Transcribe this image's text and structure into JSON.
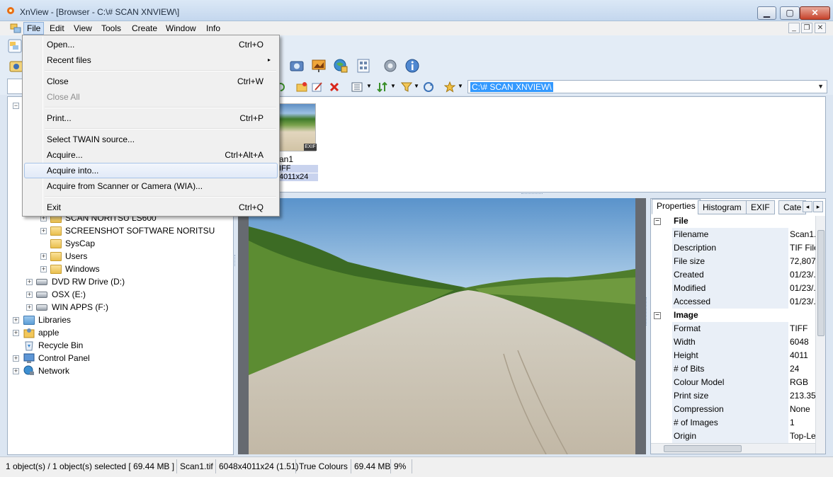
{
  "window": {
    "title": "XnView - [Browser - C:\\# SCAN XNVIEW\\]"
  },
  "menubar": {
    "items": [
      "File",
      "Edit",
      "View",
      "Tools",
      "Create",
      "Window",
      "Info"
    ]
  },
  "file_menu": {
    "items": [
      {
        "label": "Open...",
        "shortcut": "Ctrl+O"
      },
      {
        "label": "Recent files",
        "shortcut": ""
      },
      {
        "label": "Close",
        "shortcut": "Ctrl+W"
      },
      {
        "label": "Close All",
        "shortcut": ""
      },
      {
        "label": "Print...",
        "shortcut": "Ctrl+P"
      },
      {
        "label": "Select TWAIN source...",
        "shortcut": ""
      },
      {
        "label": "Acquire...",
        "shortcut": "Ctrl+Alt+A"
      },
      {
        "label": "Acquire into...",
        "shortcut": ""
      },
      {
        "label": "Acquire from Scanner or Camera (WIA)...",
        "shortcut": ""
      },
      {
        "label": "Exit",
        "shortcut": "Ctrl+Q"
      }
    ],
    "submenu_arrow": "▸"
  },
  "address": {
    "path": "C:\\# SCAN XNVIEW\\"
  },
  "tree": {
    "items": [
      {
        "label": "SCAN NORITSU LS600"
      },
      {
        "label": "SCREENSHOT SOFTWARE NORITSU"
      },
      {
        "label": "SysCap"
      },
      {
        "label": "Users"
      },
      {
        "label": "Windows"
      },
      {
        "label": "DVD RW Drive (D:)"
      },
      {
        "label": "OSX (E:)"
      },
      {
        "label": "WIN APPS (F:)"
      },
      {
        "label": "Libraries"
      },
      {
        "label": "apple"
      },
      {
        "label": "Recycle Bin"
      },
      {
        "label": "Control Panel"
      },
      {
        "label": "Network"
      }
    ]
  },
  "thumbnail": {
    "name": "an1",
    "type": "IFF",
    "dims": "4011x24",
    "badge": "EXIF"
  },
  "properties": {
    "tabs": [
      "Properties",
      "Histogram",
      "EXIF",
      "Cate"
    ],
    "sections": [
      {
        "title": "File",
        "rows": [
          {
            "key": "Filename",
            "value": "Scan1."
          },
          {
            "key": "Description",
            "value": "TIF File"
          },
          {
            "key": "File size",
            "value": "72,807,"
          },
          {
            "key": "Created",
            "value": "01/23/."
          },
          {
            "key": "Modified",
            "value": "01/23/."
          },
          {
            "key": "Accessed",
            "value": "01/23/."
          }
        ]
      },
      {
        "title": "Image",
        "rows": [
          {
            "key": "Format",
            "value": "TIFF"
          },
          {
            "key": "Width",
            "value": "6048"
          },
          {
            "key": "Height",
            "value": "4011"
          },
          {
            "key": "# of Bits",
            "value": "24"
          },
          {
            "key": "Colour Model",
            "value": "RGB"
          },
          {
            "key": "Print size",
            "value": "213.35"
          },
          {
            "key": "Compression",
            "value": "None"
          },
          {
            "key": "# of Images",
            "value": "1"
          },
          {
            "key": "Origin",
            "value": "Top-Le"
          }
        ]
      }
    ]
  },
  "statusbar": {
    "selection": "1 object(s) / 1 object(s) selected  [ 69.44 MB ]",
    "filename": "Scan1.tif",
    "dims": "6048x4011x24 (1.51)",
    "colour": "True Colours",
    "size": "69.44 MB",
    "zoom": "9%"
  },
  "colors": {
    "accent": "#3399ff",
    "menu_highlight": "#e1eaf8",
    "tree_bg": "#ffffff"
  }
}
